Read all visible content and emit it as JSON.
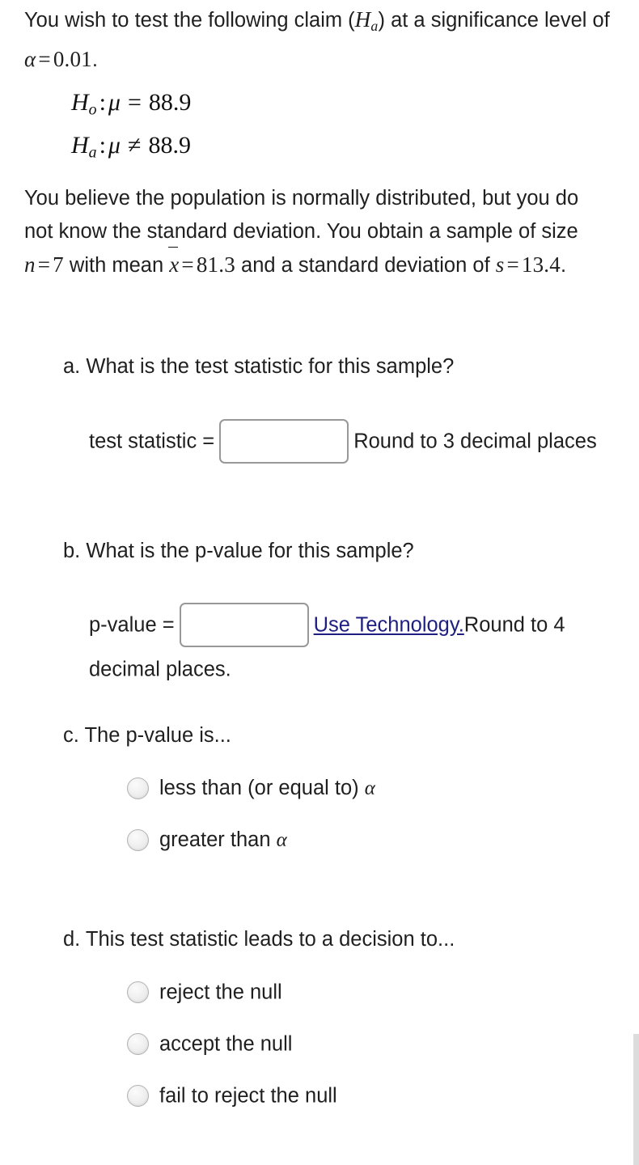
{
  "problem": {
    "intro_line1": "You wish to test the following claim (",
    "intro_claim_symbol": "H",
    "intro_claim_sub": "a",
    "intro_line1_tail": ") at a significance level of ",
    "alpha_symbol": "α",
    "alpha_equals": "=",
    "alpha_value": "0.01",
    "intro_period": ".",
    "hypotheses": {
      "null_label": "H",
      "null_sub": "o",
      "null_colon": ":",
      "null_param": "μ",
      "null_operator": "=",
      "null_value": "88.9",
      "alt_label": "H",
      "alt_sub": "a",
      "alt_colon": ":",
      "alt_param": "μ",
      "alt_operator": "≠",
      "alt_value": "88.9"
    },
    "body_part1": "You believe the population is normally distributed, but you do not know the standard deviation. You obtain a sample of size ",
    "n_symbol": "n",
    "n_equals": "=",
    "n_value": "7",
    "body_part2": " with mean ",
    "xbar_symbol": "x",
    "xbar_equals": "=",
    "xbar_value": "81.3",
    "body_part3": " and a standard deviation of ",
    "s_symbol": "s",
    "s_equals": "=",
    "s_value": "13.4",
    "body_period": "."
  },
  "parts": {
    "a": {
      "marker": "a.",
      "question": "What is the test statistic for this sample?",
      "answer_label": "test statistic =",
      "input_value": "",
      "input_placeholder": "",
      "hint": "Round to 3 decimal places"
    },
    "b": {
      "marker": "b.",
      "question": "What is the p-value for this sample?",
      "answer_label": "p-value =",
      "input_value": "",
      "input_placeholder": "",
      "link_text": "Use Technology.",
      "hint": "Round to 4 decimal places."
    },
    "c": {
      "marker": "c.",
      "question": "The p-value is...",
      "options": [
        {
          "label_text": "less than (or equal to) ",
          "label_math": "α",
          "selected": false
        },
        {
          "label_text": "greater than ",
          "label_math": "α",
          "selected": false
        }
      ]
    },
    "d": {
      "marker": "d.",
      "question": "This test statistic leads to a decision to...",
      "options": [
        {
          "label_text": "reject the null",
          "label_math": "",
          "selected": false
        },
        {
          "label_text": "accept the null",
          "label_math": "",
          "selected": false
        },
        {
          "label_text": "fail to reject the null",
          "label_math": "",
          "selected": false
        }
      ]
    }
  },
  "colors": {
    "text": "#1f1f1f",
    "link": "#1f1f82",
    "input_border": "#989898",
    "radio_border": "#b2b2b2",
    "scrollbar": "#dcdcdc",
    "background": "#ffffff"
  }
}
